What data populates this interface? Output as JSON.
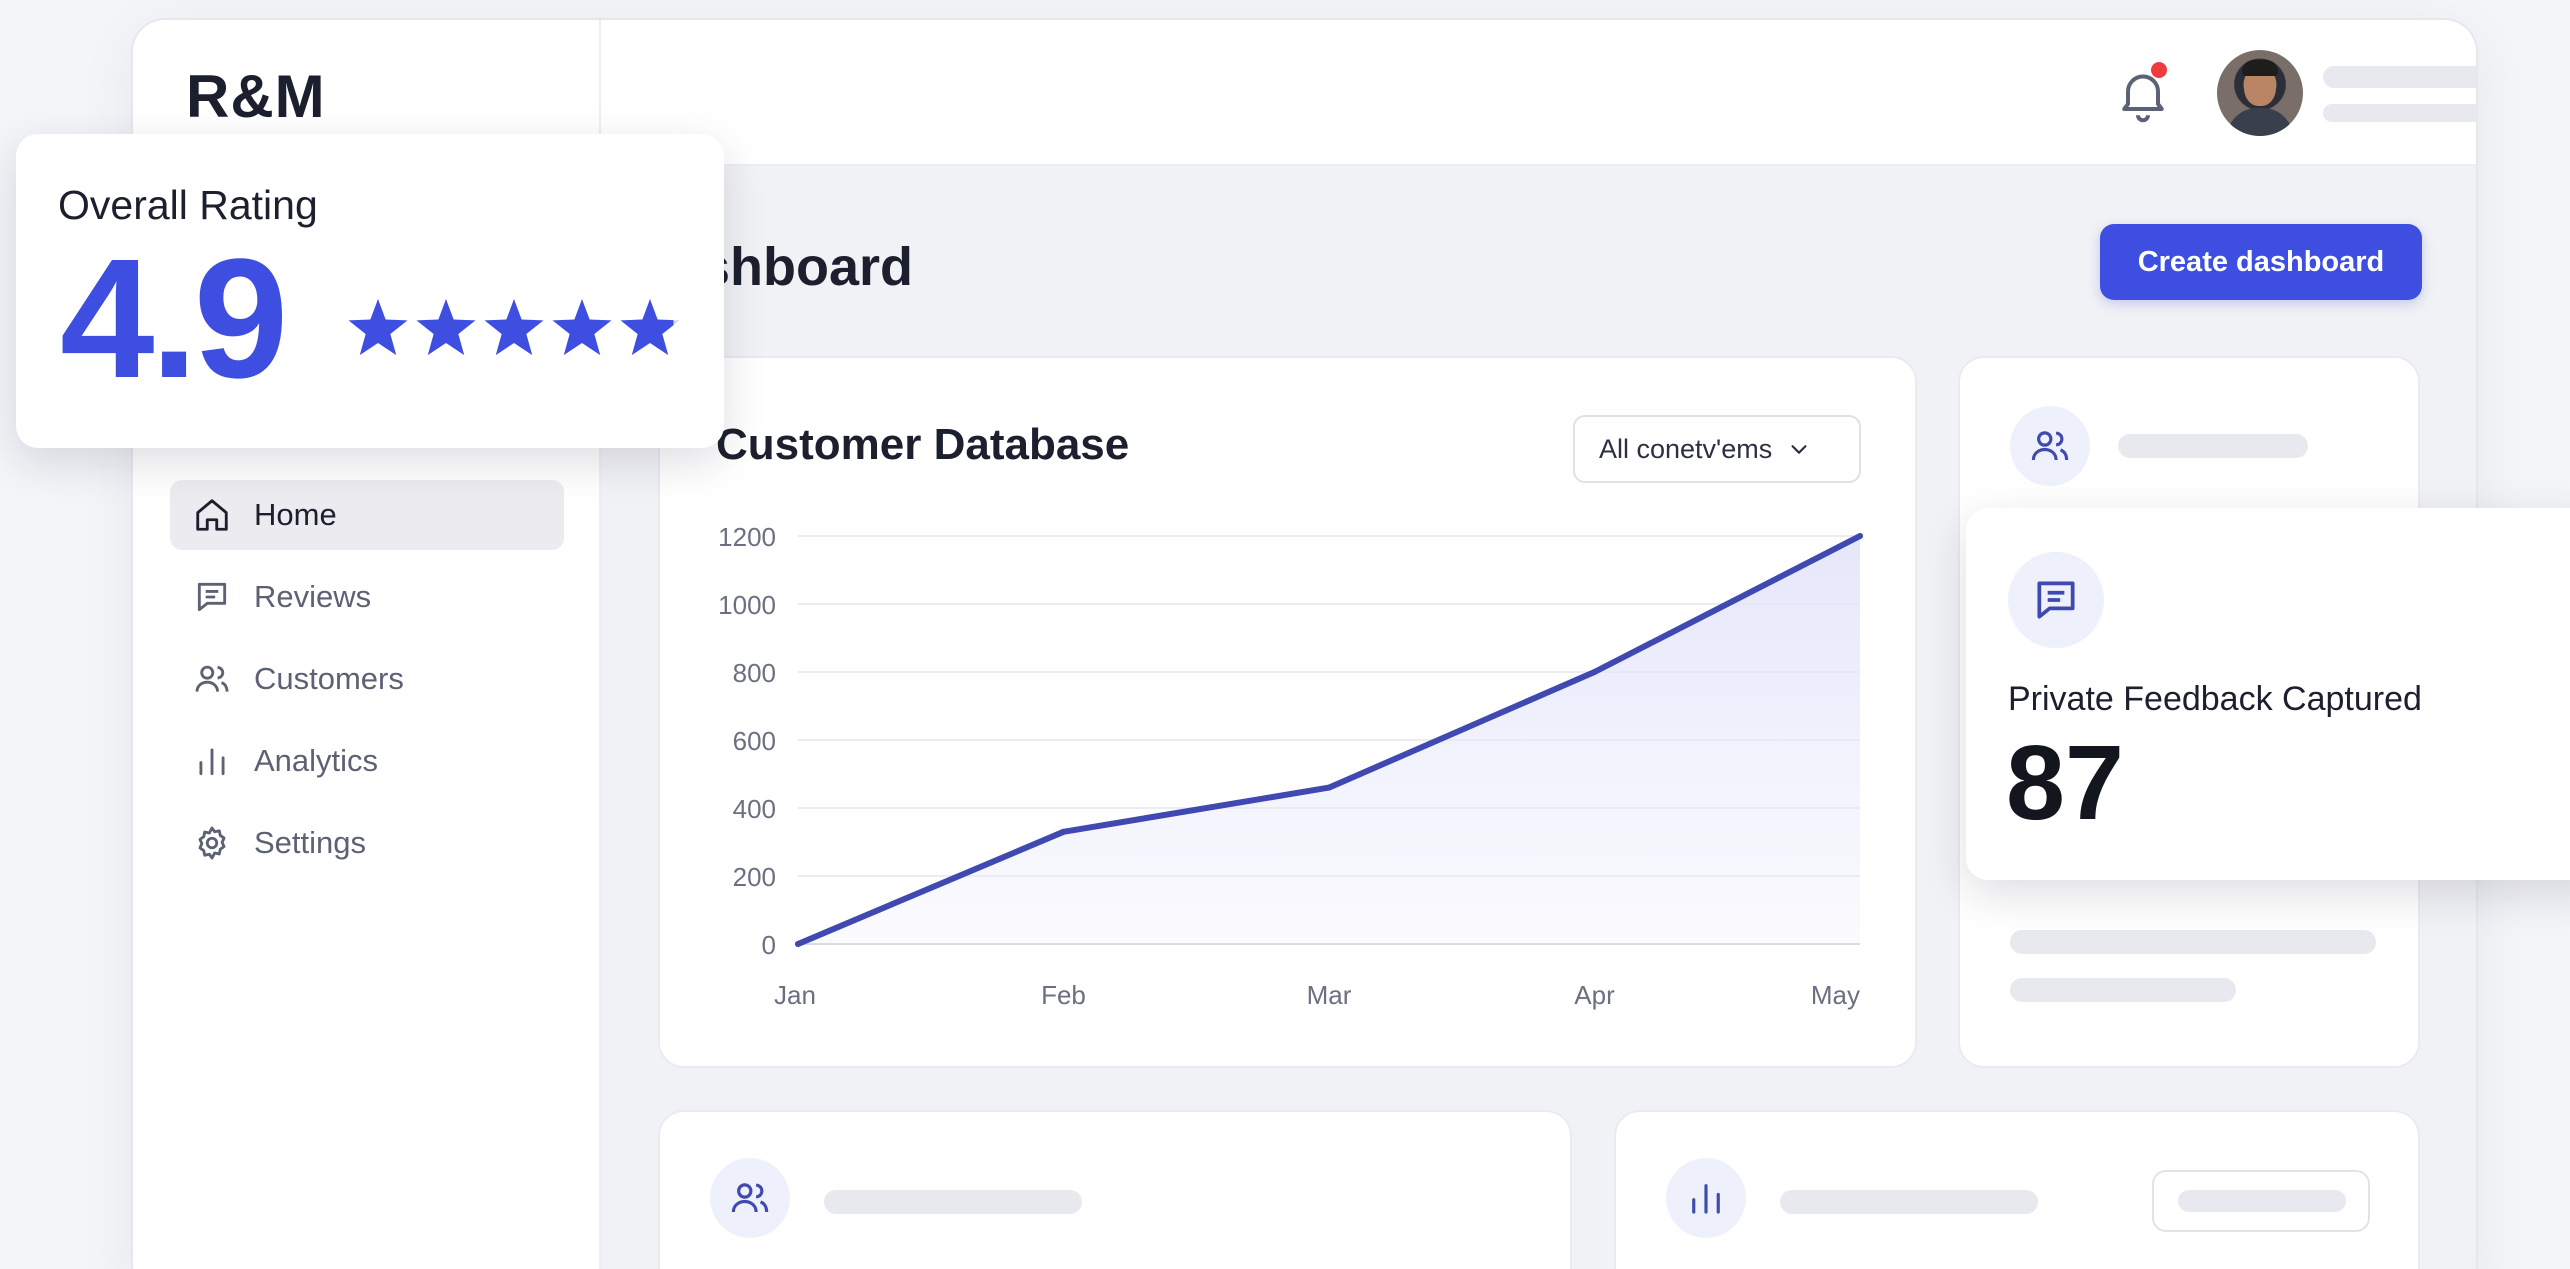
{
  "app": {
    "logo": "R&M"
  },
  "sidebar": {
    "items": [
      {
        "label": "Home",
        "icon": "home-icon",
        "active": true
      },
      {
        "label": "Reviews",
        "icon": "message-square-icon",
        "active": false
      },
      {
        "label": "Customers",
        "icon": "users-icon",
        "active": false
      },
      {
        "label": "Analytics",
        "icon": "bar-chart-icon",
        "active": false
      },
      {
        "label": "Settings",
        "icon": "gear-icon",
        "active": false
      }
    ]
  },
  "header": {
    "notification_icon": "bell-icon",
    "has_unread_notifications": true
  },
  "main": {
    "title": "shboard",
    "create_button": "Create dashboard"
  },
  "chart_card": {
    "title": "Customer Database",
    "filter": {
      "selected": "All conetv'ems"
    }
  },
  "chart_data": {
    "type": "area",
    "categories": [
      "Jan",
      "Feb",
      "Mar",
      "Apr",
      "May"
    ],
    "series": [
      {
        "values": [
          0,
          330,
          460,
          800,
          1200
        ]
      }
    ],
    "yticks": [
      0,
      200,
      400,
      600,
      800,
      1000,
      1200
    ],
    "ylim": [
      0,
      1200
    ],
    "grid": true,
    "line_color": "#3f49b0",
    "fill_color": "#e4e6fa"
  },
  "overall_rating": {
    "label": "Overall Rating",
    "value": "4.9",
    "stars": 4.9,
    "max_stars": 5,
    "accent": "#3d4ee0"
  },
  "feedback": {
    "label": "Private Feedback Captured",
    "value": "87"
  },
  "colors": {
    "accent": "#3d4ee0",
    "notification_dot": "#ef3b3b"
  }
}
